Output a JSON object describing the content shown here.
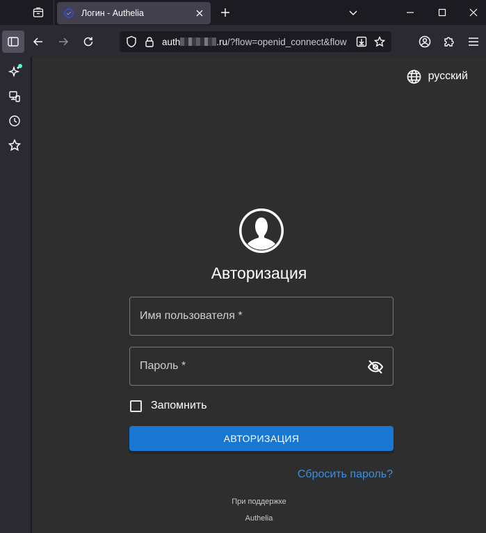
{
  "browser": {
    "tab": {
      "title": "Логин - Authelia"
    },
    "url": {
      "host_start": "auth",
      "host_end": ".ru",
      "path": "/?flow=openid_connect&flow"
    }
  },
  "login": {
    "language": "русский",
    "title": "Авторизация",
    "username_label": "Имя пользователя *",
    "password_label": "Пароль *",
    "remember_label": "Запомнить",
    "submit_label": "АВТОРИЗАЦИЯ",
    "reset_link": "Сбросить пароль?",
    "powered_by": "При поддержке",
    "powered_brand": "Authelia"
  },
  "colors": {
    "primary": "#1976d2",
    "link": "#3d8fe0",
    "page_bg": "#2e2e2e",
    "chrome_bg": "#2b2a33"
  }
}
